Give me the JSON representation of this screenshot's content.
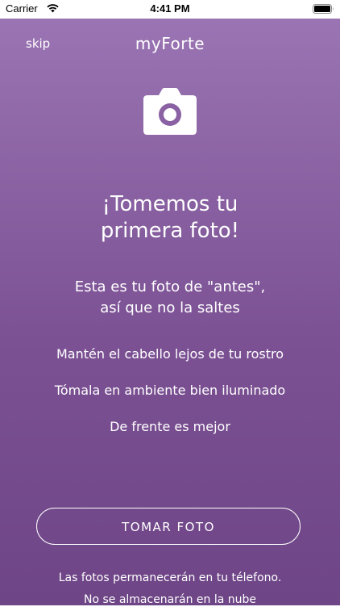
{
  "status_bar": {
    "carrier": "Carrier",
    "time": "4:41 PM",
    "icons": [
      "wifi-icon",
      "battery-icon"
    ]
  },
  "header": {
    "skip_label": "skip",
    "brand": "myForte"
  },
  "main": {
    "icon": "camera-icon",
    "headline_line1": "¡Tomemos tu",
    "headline_line2": "primera foto!",
    "subtitle_line1": "Esta es tu foto de \"antes\",",
    "subtitle_line2": "así que no la saltes",
    "tips": [
      "Mantén el cabello lejos de tu rostro",
      "Tómala en ambiente bien iluminado",
      "De frente es mejor"
    ],
    "button_label": "TOMAR FOTO",
    "footer_line1": "Las fotos permanecerán en tu télefono.",
    "footer_line2": "No se almacenarán en la nube"
  },
  "colors": {
    "gradient_top": "#9a74b3",
    "gradient_bottom": "#6e4586",
    "text": "#ffffff"
  }
}
